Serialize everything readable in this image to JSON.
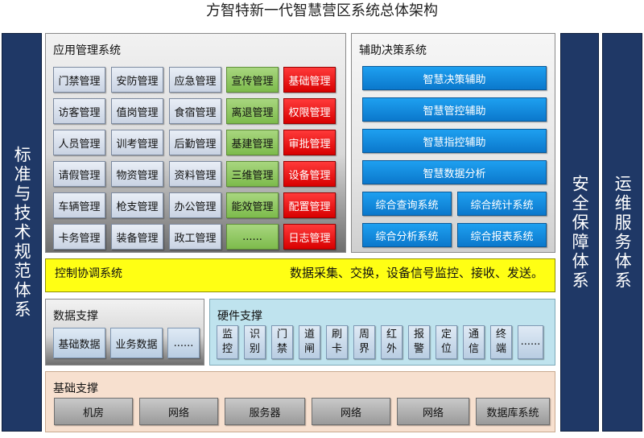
{
  "title": "方智特新一代智慧营区系统总体架构",
  "left_pillar": "标准与技术规范体系",
  "right_pillar_1": "安全保障体系",
  "right_pillar_2": "运维服务体系",
  "app_mgmt": {
    "title": "应用管理系统",
    "columns": [
      {
        "style": "blue",
        "items": [
          "门禁管理",
          "访客管理",
          "人员管理",
          "请假管理",
          "车辆管理",
          "卡务管理"
        ]
      },
      {
        "style": "blue",
        "items": [
          "安防管理",
          "值岗管理",
          "训考管理",
          "物资管理",
          "枪支管理",
          "装备管理"
        ]
      },
      {
        "style": "blue",
        "items": [
          "应急管理",
          "食宿管理",
          "后勤管理",
          "资料管理",
          "办公管理",
          "政工管理"
        ]
      },
      {
        "style": "green",
        "items": [
          "宣传管理",
          "离退管理",
          "基建管理",
          "三维管理",
          "能效管理",
          "......"
        ]
      },
      {
        "style": "red",
        "items": [
          "基础管理",
          "权限管理",
          "审批管理",
          "设备管理",
          "配置管理",
          "日志管理"
        ]
      }
    ]
  },
  "decision": {
    "title": "辅助决策系统",
    "wide_items": [
      "智慧决策辅助",
      "智慧管控辅助",
      "智慧指控辅助",
      "智慧数据分析"
    ],
    "pair_items": [
      [
        "综合查询系统",
        "综合统计系统"
      ],
      [
        "综合分析系统",
        "综合报表系统"
      ]
    ]
  },
  "control": {
    "label": "控制协调系统",
    "desc": "数据采集、交换，设备信号监控、接收、发送。"
  },
  "data_support": {
    "title": "数据支撑",
    "items": [
      "基础数据",
      "业务数据",
      "......"
    ]
  },
  "hardware": {
    "title": "硬件支撑",
    "items": [
      [
        "监",
        "控"
      ],
      [
        "识",
        "别"
      ],
      [
        "门",
        "禁"
      ],
      [
        "道",
        "闸"
      ],
      [
        "刷",
        "卡"
      ],
      [
        "周",
        "界"
      ],
      [
        "红",
        "外"
      ],
      [
        "报",
        "警"
      ],
      [
        "定",
        "位"
      ],
      [
        "通",
        "信"
      ],
      [
        "终",
        "端"
      ],
      [
        "......"
      ]
    ]
  },
  "base": {
    "title": "基础支撑",
    "items": [
      "机房",
      "网络",
      "服务器",
      "网络",
      "网络",
      "数据库系统"
    ]
  }
}
